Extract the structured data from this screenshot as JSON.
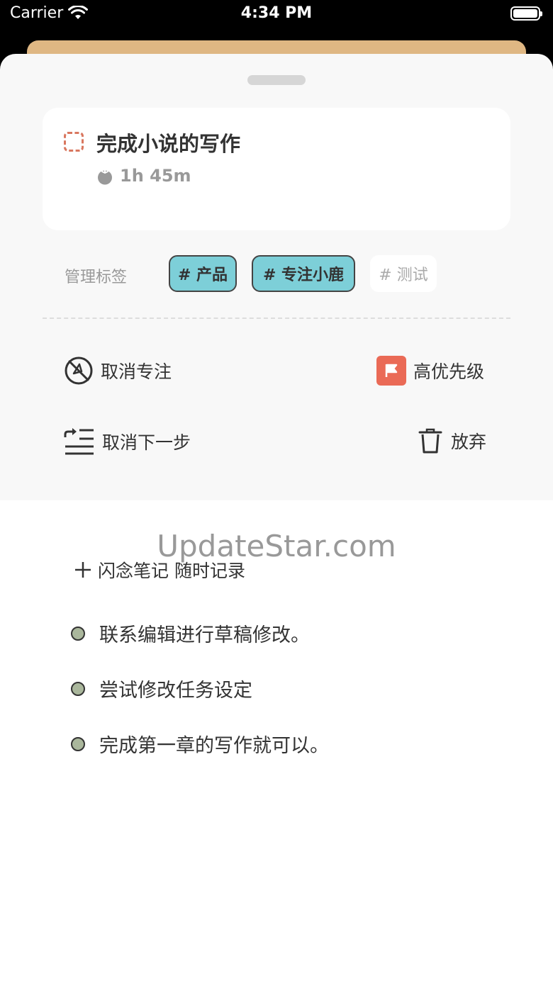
{
  "status": {
    "carrier": "Carrier",
    "time": "4:34 PM"
  },
  "task": {
    "title": "完成小说的写作",
    "duration": "1h 45m"
  },
  "tags": {
    "label": "管理标签",
    "items": [
      "# 产品",
      "# 专注小鹿",
      "# 测试"
    ]
  },
  "actions": {
    "cancel_focus": "取消专注",
    "priority": "高优先级",
    "cancel_next": "取消下一步",
    "abandon": "放弃"
  },
  "watermark": "UpdateStar.com",
  "notes": {
    "add": "闪念笔记 随时记录",
    "items": [
      "联系编辑进行草稿修改。",
      "尝试修改任务设定",
      "完成第一章的写作就可以。"
    ]
  },
  "colors": {
    "checkbox": "#d9775f",
    "tag_active": "#7dcfd8",
    "flag": "#ea6a56",
    "card_behind": "#dfb783",
    "note_dot": "#aab79c"
  }
}
